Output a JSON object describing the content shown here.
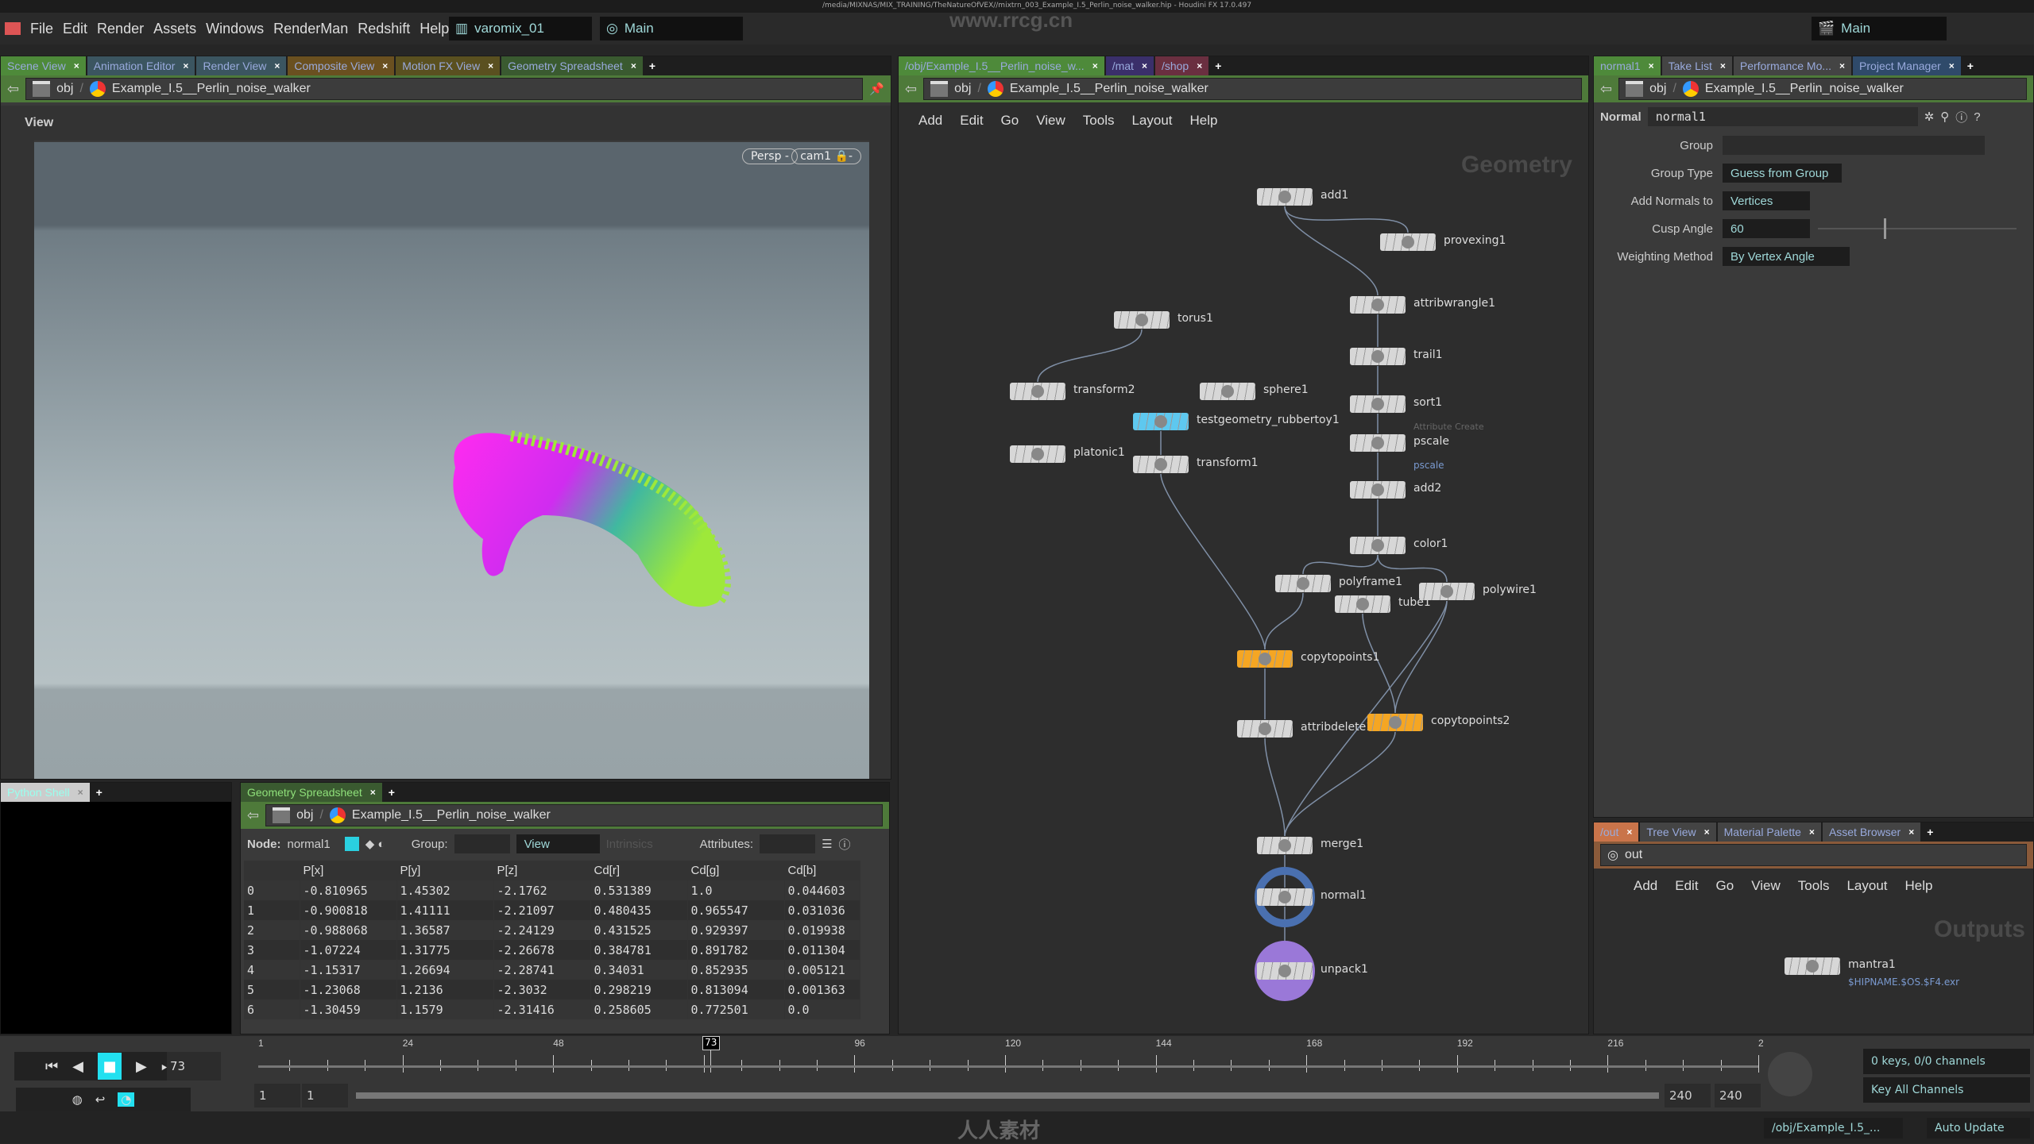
{
  "window": {
    "title": "/media/MIXNAS/MIX_TRAINING/TheNatureOfVEX//mixtrn_003_Example_I.5_Perlin_noise_walker.hip - Houdini FX 17.0.497",
    "watermark": "www.rrcg.cn",
    "bottom_watermark": "人人素材"
  },
  "menubar": {
    "items": [
      "File",
      "Edit",
      "Render",
      "Assets",
      "Windows",
      "RenderMan",
      "Redshift",
      "Help"
    ],
    "desktop": "varomix_01",
    "main": "Main",
    "right_main": "Main"
  },
  "left_pane": {
    "tabs": [
      {
        "label": "Scene View",
        "color": "#4e8a3a"
      },
      {
        "label": "Animation Editor",
        "color": "#3b5560"
      },
      {
        "label": "Render View",
        "color": "#3b5560"
      },
      {
        "label": "Composite View",
        "color": "#6a5020"
      },
      {
        "label": "Motion FX View",
        "color": "#5a5020"
      },
      {
        "label": "Geometry Spreadsheet",
        "color": "#3a5a30"
      }
    ],
    "path": {
      "root": "obj",
      "node": "Example_I.5__Perlin_noise_walker"
    },
    "view_label": "View",
    "viewport": {
      "camera_menu": "Persp",
      "cam": "cam1"
    }
  },
  "python_shell": {
    "tab": "Python Shell"
  },
  "spreadsheet": {
    "tab": "Geometry Spreadsheet",
    "path": {
      "root": "obj",
      "node": "Example_I.5__Perlin_noise_walker"
    },
    "node_label": "Node:",
    "node": "normal1",
    "group_label": "Group:",
    "view": "View",
    "intrinsics": "Intrinsics",
    "attributes_label": "Attributes:",
    "columns": [
      "",
      "P[x]",
      "P[y]",
      "P[z]",
      "Cd[r]",
      "Cd[g]",
      "Cd[b]"
    ],
    "rows": [
      [
        "0",
        "-0.810965",
        "1.45302",
        "-2.1762",
        "0.531389",
        "1.0",
        "0.044603"
      ],
      [
        "1",
        "-0.900818",
        "1.41111",
        "-2.21097",
        "0.480435",
        "0.965547",
        "0.031036"
      ],
      [
        "2",
        "-0.988068",
        "1.36587",
        "-2.24129",
        "0.431525",
        "0.929397",
        "0.019938"
      ],
      [
        "3",
        "-1.07224",
        "1.31775",
        "-2.26678",
        "0.384781",
        "0.891782",
        "0.011304"
      ],
      [
        "4",
        "-1.15317",
        "1.26694",
        "-2.28741",
        "0.34031",
        "0.852935",
        "0.005121"
      ],
      [
        "5",
        "-1.23068",
        "1.2136",
        "-2.3032",
        "0.298219",
        "0.813094",
        "0.001363"
      ],
      [
        "6",
        "-1.30459",
        "1.1579",
        "-2.31416",
        "0.258605",
        "0.772501",
        "0.0"
      ]
    ]
  },
  "network": {
    "tabs": [
      {
        "label": "/obj/Example_I.5__Perlin_noise_w...",
        "color": "#4e8a3a"
      },
      {
        "label": "/mat",
        "color": "#3a2f6a"
      },
      {
        "label": "/shop",
        "color": "#6a2f40"
      }
    ],
    "path": {
      "root": "obj",
      "node": "Example_I.5__Perlin_noise_walker"
    },
    "menu": [
      "Add",
      "Edit",
      "Go",
      "View",
      "Tools",
      "Layout",
      "Help"
    ],
    "context_label": "Geometry",
    "nodes": [
      {
        "name": "add1"
      },
      {
        "name": "provexing1"
      },
      {
        "name": "attribwrangle1"
      },
      {
        "name": "torus1"
      },
      {
        "name": "trail1"
      },
      {
        "name": "transform2"
      },
      {
        "name": "sphere1"
      },
      {
        "name": "sort1"
      },
      {
        "name": "testgeometry_rubbertoy1",
        "color": "#5ec8ef"
      },
      {
        "name": "pscale",
        "comment": "Attribute Create",
        "sublabel": "pscale"
      },
      {
        "name": "platonic1"
      },
      {
        "name": "transform1"
      },
      {
        "name": "add2"
      },
      {
        "name": "color1"
      },
      {
        "name": "polyframe1"
      },
      {
        "name": "tube1"
      },
      {
        "name": "polywire1"
      },
      {
        "name": "copytopoints1",
        "color": "#f5a623"
      },
      {
        "name": "attribdelete1"
      },
      {
        "name": "copytopoints2",
        "color": "#f5a623"
      },
      {
        "name": "merge1"
      },
      {
        "name": "normal1",
        "display": true
      },
      {
        "name": "unpack1",
        "render": true
      }
    ],
    "edges": [
      [
        "add1",
        "provexing1"
      ],
      [
        "add1",
        "attribwrangle1"
      ],
      [
        "attribwrangle1",
        "trail1"
      ],
      [
        "trail1",
        "sort1"
      ],
      [
        "sort1",
        "pscale"
      ],
      [
        "pscale",
        "add2"
      ],
      [
        "add2",
        "color1"
      ],
      [
        "torus1",
        "transform2"
      ],
      [
        "testgeometry_rubbertoy1",
        "transform1"
      ],
      [
        "transform1",
        "copytopoints1"
      ],
      [
        "color1",
        "polyframe1"
      ],
      [
        "color1",
        "polywire1"
      ],
      [
        "polyframe1",
        "copytopoints1"
      ],
      [
        "tube1",
        "copytopoints2"
      ],
      [
        "polywire1",
        "copytopoints2"
      ],
      [
        "polywire1",
        "merge1"
      ],
      [
        "copytopoints1",
        "attribdelete1"
      ],
      [
        "attribdelete1",
        "merge1"
      ],
      [
        "copytopoints2",
        "merge1"
      ],
      [
        "merge1",
        "normal1"
      ],
      [
        "normal1",
        "unpack1"
      ]
    ]
  },
  "params": {
    "tabs": [
      {
        "label": "normal1",
        "color": "#4e8a3a"
      },
      {
        "label": "Take List",
        "color": "#444"
      },
      {
        "label": "Performance Mo...",
        "color": "#444"
      },
      {
        "label": "Project Manager",
        "color": "#2f4a6a"
      }
    ],
    "path": {
      "root": "obj",
      "node": "Example_I.5__Perlin_noise_walker"
    },
    "type": "Normal",
    "node_name": "normal1",
    "fields": [
      {
        "label": "Group",
        "value": ""
      },
      {
        "label": "Group Type",
        "value": "Guess from Group"
      },
      {
        "label": "Add Normals to",
        "value": "Vertices"
      },
      {
        "label": "Cusp Angle",
        "value": "60"
      },
      {
        "label": "Weighting Method",
        "value": "By Vertex Angle"
      }
    ],
    "cusp_angle_slider": 60
  },
  "outputs": {
    "tabs": [
      {
        "label": "/out",
        "color": "#c9744a"
      },
      {
        "label": "Tree View",
        "color": "#444"
      },
      {
        "label": "Material Palette",
        "color": "#444"
      },
      {
        "label": "Asset Browser",
        "color": "#444"
      }
    ],
    "path": "out",
    "menu": [
      "Add",
      "Edit",
      "Go",
      "View",
      "Tools",
      "Layout",
      "Help"
    ],
    "context_label": "Outputs",
    "node": "mantra1",
    "node_output": "$HIPNAME.$OS.$F4.exr"
  },
  "timeline": {
    "current_frame": "73",
    "start": 1,
    "end": 240,
    "tick_labels": [
      "1",
      "24",
      "48",
      "72",
      "96",
      "120",
      "144",
      "168",
      "192",
      "216",
      "2"
    ],
    "range_start": "1",
    "range_start2": "1",
    "range_end": "240",
    "range_end2": "240",
    "keys": "0 keys, 0/0 channels",
    "key_all": "Key All Channels",
    "accent": "#22e0f0"
  },
  "statusbar": {
    "path": "/obj/Example_I.5_...",
    "update": "Auto Update"
  }
}
